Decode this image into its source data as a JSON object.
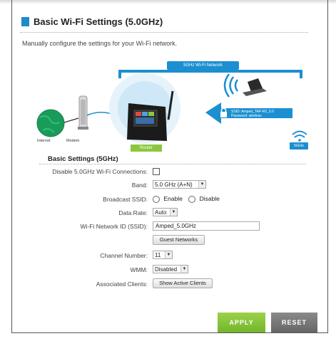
{
  "page": {
    "title": "Basic Wi-Fi Settings (5.0GHz)",
    "subtitle": "Manually configure the settings for your Wi-Fi network."
  },
  "diagram": {
    "network_banner": "5GHz Wi-Fi Network",
    "internet_label": "Internet",
    "modem_label": "Modem",
    "router_label": "Router",
    "band_tag": "5GHz",
    "ssid_line": "SSID: Amped_TAP-R2_5.0",
    "password_line": "Password: wireless",
    "colors": {
      "blue": "#1b8fd0",
      "green": "#8cc63f",
      "globe": "#1a9b5a"
    }
  },
  "form": {
    "section_title": "Basic Settings (5GHz)",
    "disable_label": "Disable 5.0GHz Wi-Fi Connections:",
    "disable_checked": false,
    "band_label": "Band:",
    "band_value": "5.0 GHz (A+N)",
    "broadcast_label": "Broadcast SSID:",
    "enable_label": "Enable",
    "disable_option_label": "Disable",
    "data_rate_label": "Data Rate:",
    "data_rate_value": "Auto",
    "ssid_label": "Wi-Fi Network ID (SSID):",
    "ssid_value": "Amped_5.0GHz",
    "guest_button": "Guest Networks",
    "channel_label": "Channel Number:",
    "channel_value": "11",
    "wmm_label": "WMM:",
    "wmm_value": "Disabled",
    "clients_label": "Associated Clients:",
    "clients_button": "Show Active Clients"
  },
  "actions": {
    "apply": "APPLY",
    "reset": "RESET"
  }
}
